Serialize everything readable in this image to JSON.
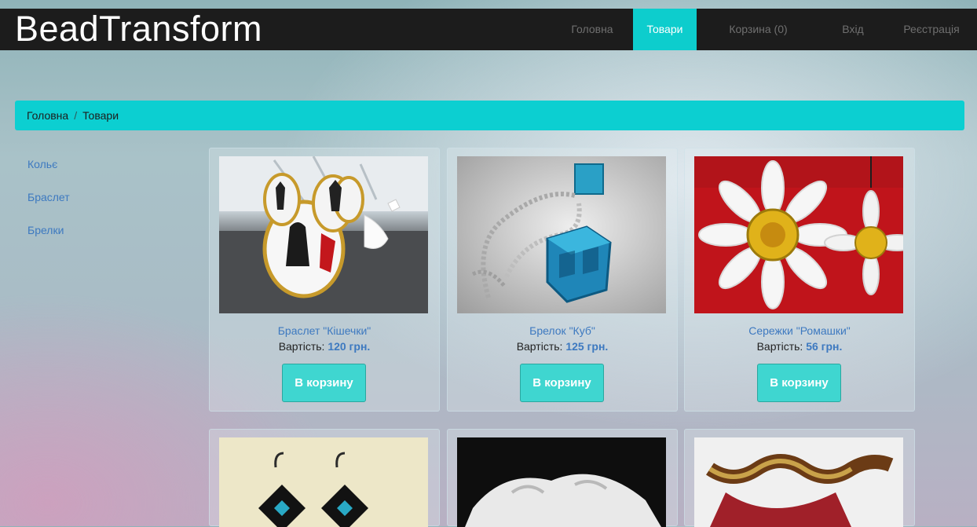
{
  "brand": "BeadTransform",
  "nav": {
    "items": [
      {
        "label": "Головна"
      },
      {
        "label": "Товари"
      },
      {
        "label": "Корзина (0)"
      },
      {
        "label": "Вхід"
      },
      {
        "label": "Реєстрація"
      }
    ]
  },
  "breadcrumb": {
    "home": "Головна",
    "separator": "/",
    "current": "Товари"
  },
  "sidebar": {
    "items": [
      {
        "label": "Кольє"
      },
      {
        "label": "Браслет"
      },
      {
        "label": "Брелки"
      }
    ]
  },
  "price_label": "Вартість:",
  "add_to_cart_label": "В корзину",
  "products": [
    {
      "title": "Браслет \"Кішечки\"",
      "price": "120 грн.",
      "image": "bracelet-cats-photo"
    },
    {
      "title": "Брелок \"Куб\"",
      "price": "125 грн.",
      "image": "keychain-cube-photo"
    },
    {
      "title": "Сережки \"Ромашки\"",
      "price": "56 грн.",
      "image": "earrings-daisies-photo"
    }
  ],
  "products_row2": [
    {
      "image": "earrings-turquoise-photo"
    },
    {
      "image": "white-beads-photo"
    },
    {
      "image": "bracelet-red-photo"
    }
  ],
  "colors": {
    "navbar": "#1c1c1c",
    "accent": "#0dcdcd",
    "link": "#3d79c0",
    "button": "#3fd6d0"
  }
}
